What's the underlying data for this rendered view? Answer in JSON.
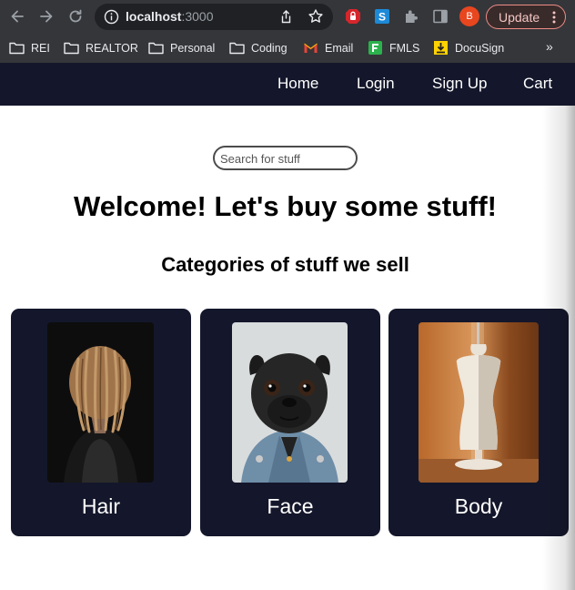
{
  "browser": {
    "url_host": "localhost",
    "url_port": ":3000",
    "profile_initial": "B",
    "update_label": "Update",
    "bookmarks": [
      {
        "label": "REI",
        "icon": "folder-icon"
      },
      {
        "label": "REALTOR",
        "icon": "folder-icon"
      },
      {
        "label": "Personal",
        "icon": "folder-icon"
      },
      {
        "label": "Coding",
        "icon": "folder-icon"
      },
      {
        "label": "Email",
        "icon": "gmail-icon"
      },
      {
        "label": "FMLS",
        "icon": "fmls-icon"
      },
      {
        "label": "DocuSign",
        "icon": "docusign-icon"
      }
    ],
    "more_bookmarks": "»"
  },
  "nav": {
    "home": "Home",
    "login": "Login",
    "signup": "Sign Up",
    "cart": "Cart"
  },
  "search": {
    "placeholder": "Search for stuff",
    "value": ""
  },
  "main": {
    "welcome": "Welcome! Let's buy some stuff!",
    "categories_heading": "Categories of stuff we sell"
  },
  "categories": [
    {
      "label": "Hair"
    },
    {
      "label": "Face"
    },
    {
      "label": "Body"
    }
  ],
  "colors": {
    "nav_bg": "#14172b",
    "card_bg": "#14172b",
    "update_accent": "#ee8d86"
  }
}
